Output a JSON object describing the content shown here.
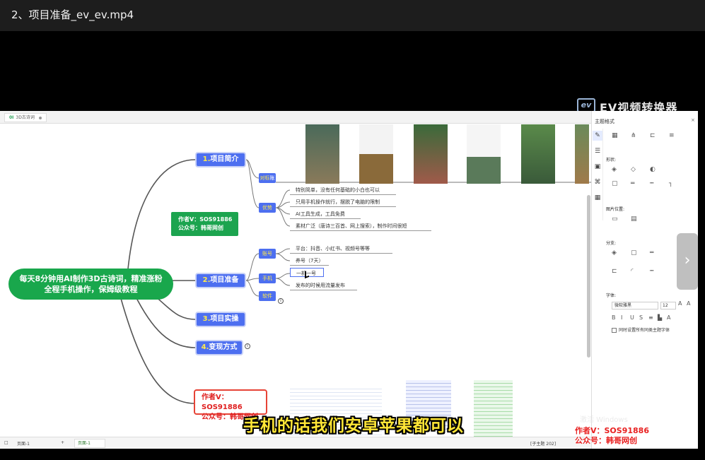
{
  "video": {
    "title": "2、项目准备_ev_ev.mp4"
  },
  "ev_watermark": {
    "logo": "ev",
    "text": "EV视频转换器"
  },
  "app": {
    "tab_label": "3D古诗词",
    "tab_mark": "0I"
  },
  "mindmap": {
    "central": {
      "line1": "每天8分钟用AI制作3D古诗词，精准涨粉",
      "line2": "全程手机操作，保姆级教程"
    },
    "branches": [
      {
        "num": "1.",
        "label": "项目简介"
      },
      {
        "num": "2.",
        "label": "项目准备"
      },
      {
        "num": "3.",
        "label": "项目实操"
      },
      {
        "num": "4.",
        "label": "变现方式"
      }
    ],
    "sub1": {
      "target_label_yellow": "对标",
      "target_label": "账号",
      "advantage_label": "优势",
      "advantages": [
        "特别简单，没有任何基础的小白也可以",
        "只用手机操作就行，摆脱了电脑的限制",
        "AI工具生成，工具免费",
        "素材广泛（唐诗三百首、网上搜索），制作时间很短"
      ]
    },
    "sub2": {
      "account_label": "账号",
      "phone_label": "手机",
      "software_label": "软件",
      "leaves": [
        "平台：抖音、小红书、视频号等等",
        "养号（7天）",
        "一机一号",
        "发布的时候用流量发布"
      ],
      "info_icon": "i"
    },
    "branch4_info": "i",
    "author_green": {
      "line1": "作者V：SOS91886",
      "line2": "公众号：韩哥网创"
    },
    "author_red": {
      "line1": "作者V：SOS91886",
      "line2": "公众号：韩哥网创"
    }
  },
  "panel": {
    "title": "主题格式",
    "close": "×",
    "sections": {
      "shape": "形状:",
      "image_pos": "图片位置:",
      "branch": "分支:",
      "font": "字体:"
    },
    "font_name": "微软雅黑",
    "font_size": "12",
    "checkbox": "同时设置所有同类主题字体"
  },
  "status": {
    "page_left": "页面-1",
    "page_tab": "页面-1",
    "plus": "+",
    "topic_count": "[子主题 202]"
  },
  "player": {
    "next_icon": "›"
  },
  "subtitle": "手机的话我们安卓苹果都可以",
  "activate_text": "激活 Windows",
  "bottom_watermark": {
    "line1": "作者V：SOS91886",
    "line2": "公众号：韩哥网创"
  }
}
